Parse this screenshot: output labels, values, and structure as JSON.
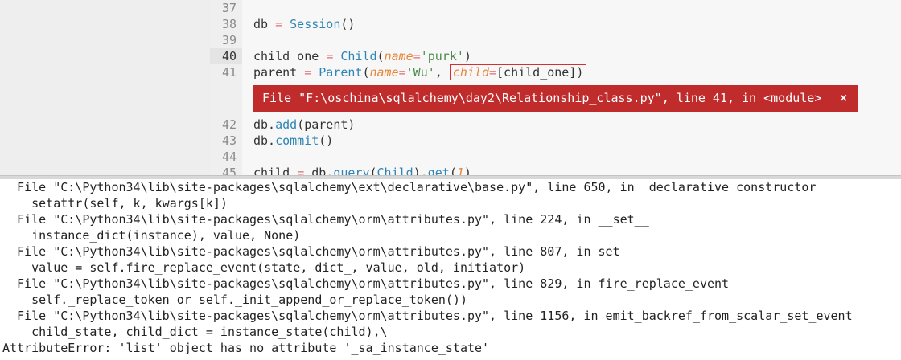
{
  "editor": {
    "lines": [
      {
        "num": "37",
        "segments": []
      },
      {
        "num": "38",
        "segments": [
          {
            "t": "db ",
            "c": ""
          },
          {
            "t": "=",
            "c": "op"
          },
          {
            "t": " ",
            "c": ""
          },
          {
            "t": "Session",
            "c": "cls"
          },
          {
            "t": "()",
            "c": ""
          }
        ]
      },
      {
        "num": "39",
        "segments": []
      },
      {
        "num": "40",
        "segments": [
          {
            "t": "child_one ",
            "c": ""
          },
          {
            "t": "=",
            "c": "op"
          },
          {
            "t": " ",
            "c": ""
          },
          {
            "t": "Child",
            "c": "cls"
          },
          {
            "t": "(",
            "c": ""
          },
          {
            "t": "name",
            "c": "prm"
          },
          {
            "t": "=",
            "c": "op"
          },
          {
            "t": "'purk'",
            "c": "str"
          },
          {
            "t": ")",
            "c": ""
          }
        ],
        "current": true
      },
      {
        "num": "41",
        "segments": [
          {
            "t": "parent ",
            "c": ""
          },
          {
            "t": "=",
            "c": "op"
          },
          {
            "t": " ",
            "c": ""
          },
          {
            "t": "Parent",
            "c": "cls"
          },
          {
            "t": "(",
            "c": ""
          },
          {
            "t": "name",
            "c": "prm"
          },
          {
            "t": "=",
            "c": "op"
          },
          {
            "t": "'Wu'",
            "c": "str"
          },
          {
            "t": ", ",
            "c": ""
          }
        ],
        "boxed": [
          {
            "t": "child",
            "c": "prm"
          },
          {
            "t": "=",
            "c": "op"
          },
          {
            "t": "[child_one])",
            "c": ""
          }
        ]
      },
      {
        "num": "42",
        "segments": [
          {
            "t": "db.",
            "c": ""
          },
          {
            "t": "add",
            "c": "fn"
          },
          {
            "t": "(parent)",
            "c": ""
          }
        ]
      },
      {
        "num": "43",
        "segments": [
          {
            "t": "db.",
            "c": ""
          },
          {
            "t": "commit",
            "c": "fn"
          },
          {
            "t": "()",
            "c": ""
          }
        ]
      },
      {
        "num": "44",
        "segments": []
      },
      {
        "num": "45",
        "segments": [
          {
            "t": "child ",
            "c": ""
          },
          {
            "t": "=",
            "c": "op"
          },
          {
            "t": " db.",
            "c": ""
          },
          {
            "t": "query",
            "c": "fn"
          },
          {
            "t": "(",
            "c": ""
          },
          {
            "t": "Child",
            "c": "cls"
          },
          {
            "t": ").",
            "c": ""
          },
          {
            "t": "get",
            "c": "fn"
          },
          {
            "t": "(",
            "c": ""
          },
          {
            "t": "1",
            "c": "prm"
          },
          {
            "t": ")",
            "c": ""
          }
        ]
      }
    ],
    "error_bar": {
      "text": "File \"F:\\oschina\\sqlalchemy\\day2\\Relationship_class.py\", line 41, in <module>",
      "close_label": "×"
    }
  },
  "console": {
    "lines": [
      "  File \"C:\\Python34\\lib\\site-packages\\sqlalchemy\\ext\\declarative\\base.py\", line 650, in _declarative_constructor",
      "    setattr(self, k, kwargs[k])",
      "  File \"C:\\Python34\\lib\\site-packages\\sqlalchemy\\orm\\attributes.py\", line 224, in __set__",
      "    instance_dict(instance), value, None)",
      "  File \"C:\\Python34\\lib\\site-packages\\sqlalchemy\\orm\\attributes.py\", line 807, in set",
      "    value = self.fire_replace_event(state, dict_, value, old, initiator)",
      "  File \"C:\\Python34\\lib\\site-packages\\sqlalchemy\\orm\\attributes.py\", line 829, in fire_replace_event",
      "    self._replace_token or self._init_append_or_replace_token())",
      "  File \"C:\\Python34\\lib\\site-packages\\sqlalchemy\\orm\\attributes.py\", line 1156, in emit_backref_from_scalar_set_event",
      "    child_state, child_dict = instance_state(child),\\",
      "AttributeError: 'list' object has no attribute '_sa_instance_state'"
    ]
  }
}
